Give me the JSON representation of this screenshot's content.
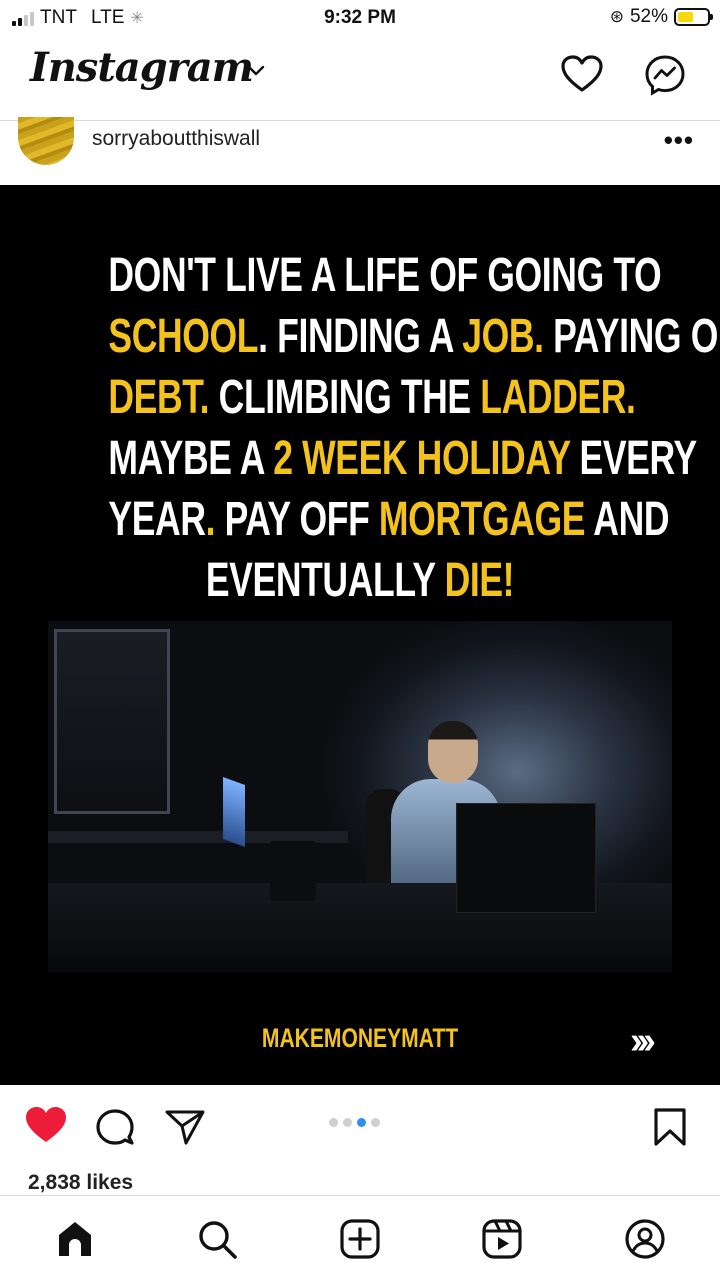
{
  "status_bar": {
    "carrier": "TNT",
    "network": "LTE",
    "time": "9:32 PM",
    "battery_percent": "52%",
    "battery_level": 0.52,
    "battery_color": "#f5d90a"
  },
  "header": {
    "logo": "Instagram",
    "icons": [
      "chevron-down-icon",
      "heart-icon",
      "messenger-icon"
    ]
  },
  "post": {
    "username": "sorryaboutthiswall",
    "more_label": "•••",
    "headline_lines": [
      [
        {
          "t": "DON'T LIVE A LIFE OF GOING TO",
          "y": false
        }
      ],
      [
        {
          "t": "SCHOOL",
          "y": true
        },
        {
          "t": ". FINDING A ",
          "y": false
        },
        {
          "t": "JOB.",
          "y": true
        },
        {
          "t": " PAYING OFF",
          "y": false
        }
      ],
      [
        {
          "t": "DEBT.",
          "y": true
        },
        {
          "t": " CLIMBING THE ",
          "y": false
        },
        {
          "t": "LADDER.",
          "y": true
        }
      ],
      [
        {
          "t": "MAYBE A ",
          "y": false
        },
        {
          "t": "2 WEEK HOLIDAY",
          "y": true
        },
        {
          "t": " EVERY",
          "y": false
        }
      ],
      [
        {
          "t": "YEAR",
          "y": false
        },
        {
          "t": ".",
          "y": true
        },
        {
          "t": " PAY OFF ",
          "y": false
        },
        {
          "t": "MORTGAGE",
          "y": true
        },
        {
          "t": " AND",
          "y": false
        }
      ],
      [
        {
          "t": "EVENTUALLY ",
          "y": false
        },
        {
          "t": "DIE!",
          "y": true
        }
      ]
    ],
    "image_alt": "man covering face at desk in dark office",
    "watermark": "MAKEMONEYMATT",
    "next_arrows": "›››",
    "accent_color": "#f4c21d",
    "carousel_total": 4,
    "carousel_active": 3
  },
  "actions": {
    "liked": true,
    "like_color": "#ed1d3a",
    "likes_text": "2,838 likes"
  },
  "tabbar": {
    "items": [
      "home-icon",
      "search-icon",
      "new-post-icon",
      "reels-icon",
      "profile-icon"
    ]
  }
}
